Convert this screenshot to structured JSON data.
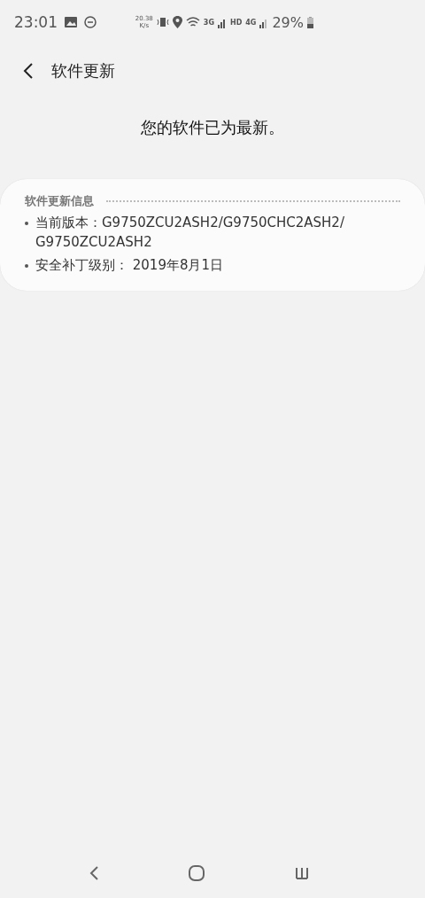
{
  "status_bar": {
    "time": "23:01",
    "speed_value": "20.38",
    "speed_unit": "K/s",
    "network_3g": "3G",
    "hd": "HD",
    "network_4g": "4G",
    "battery": "29%"
  },
  "header": {
    "title": "软件更新"
  },
  "message": "您的软件已为最新。",
  "info_card": {
    "heading": "软件更新信息",
    "items": [
      "当前版本：G9750ZCU2ASH2/G9750CHC2ASH2/ G9750ZCU2ASH2",
      "安全补丁级别： 2019年8月1日"
    ]
  }
}
